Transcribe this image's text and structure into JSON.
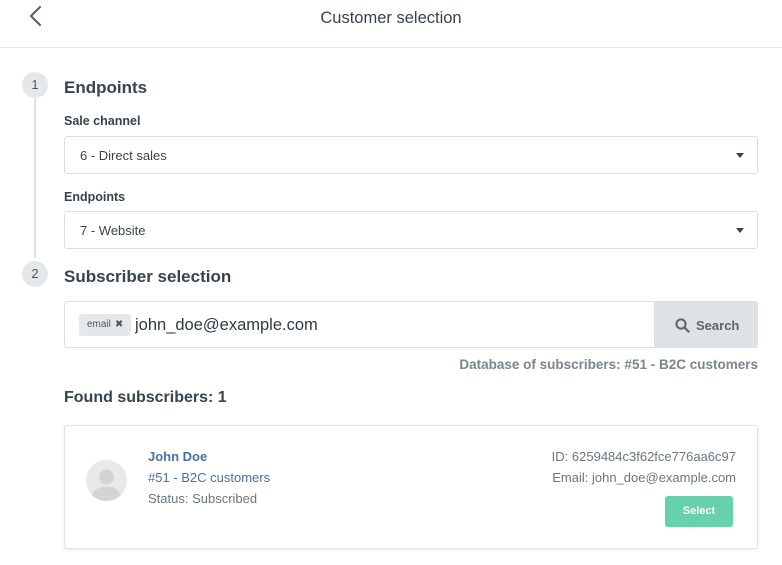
{
  "header": {
    "title": "Customer selection",
    "back_icon": "chevron-left-icon"
  },
  "steps": [
    {
      "number": "1",
      "title": "Endpoints"
    },
    {
      "number": "2",
      "title": "Subscriber selection"
    }
  ],
  "endpoints": {
    "sale_channel_label": "Sale channel",
    "sale_channel_value": "6 - Direct sales",
    "endpoints_label": "Endpoints",
    "endpoints_value": "7 - Website"
  },
  "search": {
    "tag_label": "email",
    "tag_close": "✖",
    "query": "john_doe@example.com",
    "button_label": "Search",
    "button_icon": "search-icon",
    "database_info": "Database of subscribers: #51 - B2C customers"
  },
  "results": {
    "found_label": "Found subscribers: 1",
    "items": [
      {
        "name": "John Doe",
        "database": "#51 - B2C customers",
        "status": "Status: Subscribed",
        "id": "ID: 6259484c3f62fce776aa6c97",
        "email": "Email: john_doe@example.com",
        "select_label": "Select",
        "avatar_icon": "user-avatar-icon"
      }
    ]
  },
  "colors": {
    "accent_link": "#4a6ea9",
    "select_button": "#66d1ab",
    "badge_bg": "#e5e8eb"
  }
}
